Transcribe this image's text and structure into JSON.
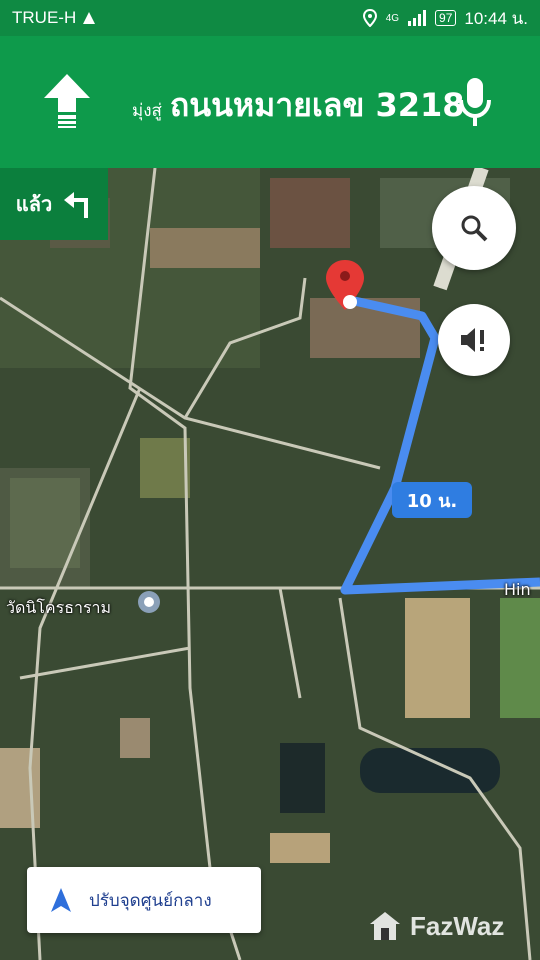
{
  "status_bar": {
    "carrier": "TRUE-H",
    "network": "4G",
    "battery": "97",
    "time": "10:44 น."
  },
  "navigation": {
    "direction": "straight-arrow-icon",
    "prefix": "มุ่งสู่",
    "road": "ถนนหมายเลข 3218",
    "then_label": "แล้ว",
    "then_icon": "turn-left-icon"
  },
  "map": {
    "eta": "10 น.",
    "temple_label": "วัดนิโครธาราม",
    "road_label": "Hin"
  },
  "buttons": {
    "search_icon": "search-icon",
    "sound_icon": "volume-alert-icon",
    "recenter_label": "ปรับจุดศูนย์กลาง"
  },
  "watermark": "FazWaz",
  "colors": {
    "header_green": "#0e9a4b",
    "route_blue": "#4a8cf0",
    "pin_red": "#e53935"
  }
}
